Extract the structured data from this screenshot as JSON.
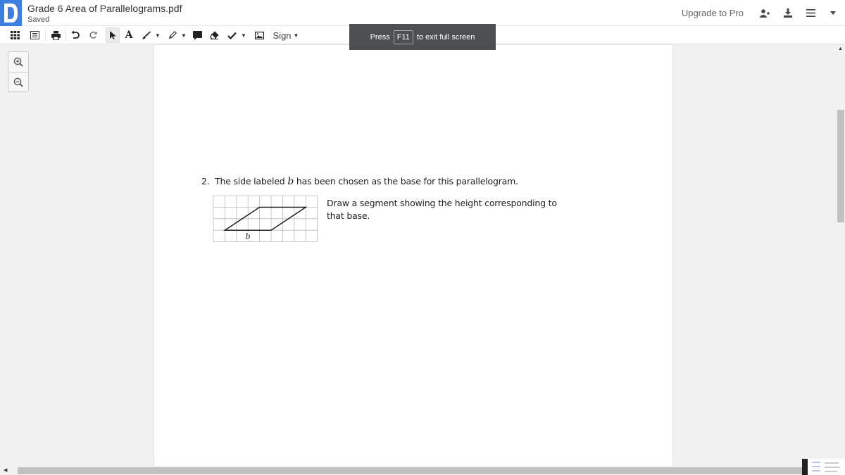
{
  "header": {
    "app_logo": "D",
    "title": "Grade 6 Area of Parallelograms.pdf",
    "status": "Saved",
    "upgrade_label": "Upgrade to Pro",
    "icons": [
      "add-user-icon",
      "download-icon",
      "menu-icon",
      "caret-down-icon"
    ]
  },
  "toolbar": {
    "items": [
      {
        "name": "thumbnails-grid",
        "icon": "grid-icon"
      },
      {
        "name": "outline",
        "icon": "list-icon"
      },
      {
        "name": "print",
        "icon": "print-icon"
      },
      {
        "name": "undo",
        "icon": "undo-icon"
      },
      {
        "name": "redo",
        "icon": "redo-icon"
      },
      {
        "name": "select",
        "icon": "cursor-icon",
        "selected": true
      },
      {
        "name": "text",
        "icon": "text-icon"
      },
      {
        "name": "draw",
        "icon": "brush-icon"
      },
      {
        "name": "highlight",
        "icon": "highlighter-icon"
      },
      {
        "name": "comment",
        "icon": "comment-icon"
      },
      {
        "name": "eraser",
        "icon": "eraser-icon"
      },
      {
        "name": "checkmark",
        "icon": "check-icon"
      },
      {
        "name": "image",
        "icon": "image-icon"
      }
    ],
    "sign_label": "Sign"
  },
  "fullscreen_toast": {
    "prefix": "Press",
    "key": "F11",
    "suffix": "to exit full screen"
  },
  "zoom_controls": {
    "zoom_in": "zoom-in-icon",
    "zoom_out": "zoom-out-icon"
  },
  "document": {
    "question_number": "2.",
    "question_before": "The side labeled ",
    "question_var": "b",
    "question_after": " has been chosen as the base for this parallelogram.",
    "instruction": "Draw a segment showing the height corresponding to that base.",
    "figure": {
      "grid_columns": 9,
      "grid_rows": 4,
      "parallelogram_grid_points": [
        [
          1,
          3
        ],
        [
          5,
          3
        ],
        [
          8,
          1
        ],
        [
          4,
          1
        ]
      ],
      "base_label": "b"
    }
  }
}
